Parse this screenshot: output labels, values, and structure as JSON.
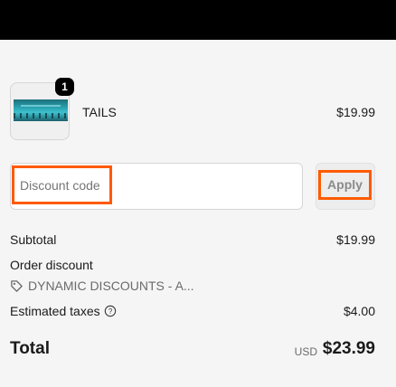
{
  "cart": {
    "item": {
      "quantity": "1",
      "name": "TAILS",
      "price": "$19.99"
    }
  },
  "discount": {
    "placeholder": "Discount code",
    "apply_label": "Apply"
  },
  "summary": {
    "subtotal_label": "Subtotal",
    "subtotal_value": "$19.99",
    "order_discount_label": "Order discount",
    "discount_name": "DYNAMIC DISCOUNTS - A...",
    "taxes_label": "Estimated taxes",
    "taxes_value": "$4.00",
    "total_label": "Total",
    "currency": "USD",
    "total_value": "$23.99"
  },
  "colors": {
    "highlight": "#ff5a00",
    "background": "#f5f5f5"
  }
}
